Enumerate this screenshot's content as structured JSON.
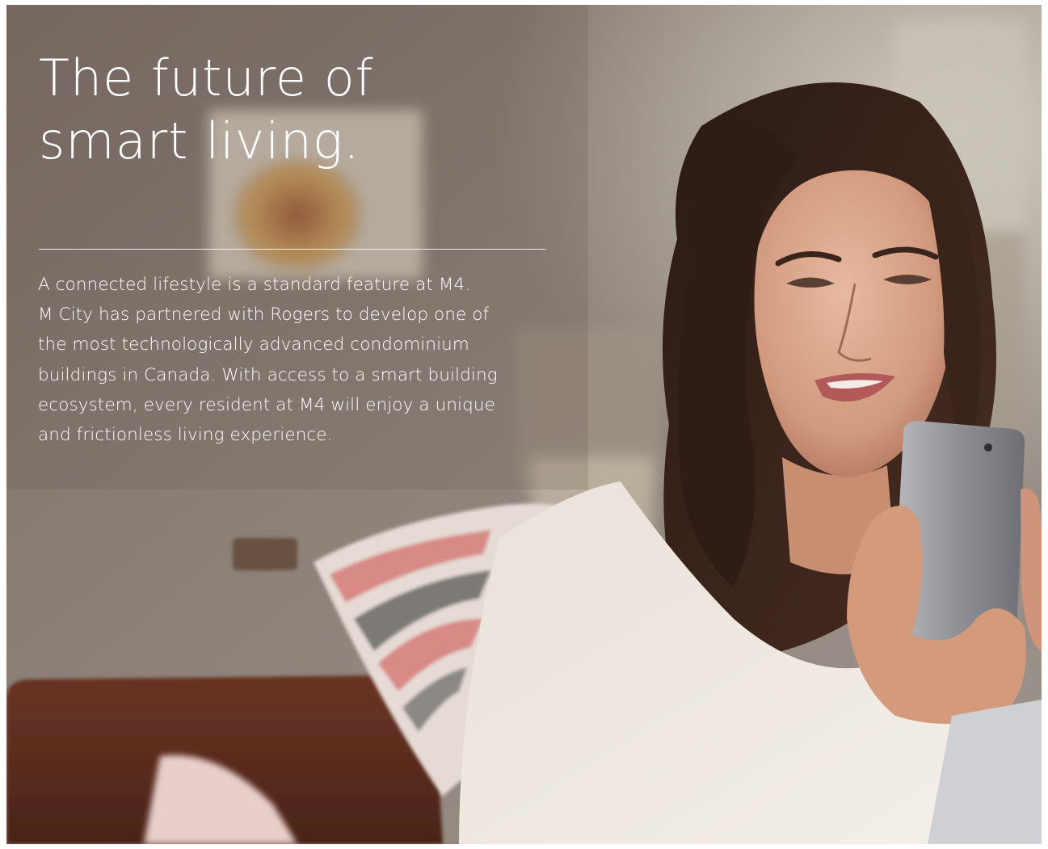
{
  "headline": {
    "line1": "The future of",
    "line2": "smart living."
  },
  "body": {
    "lines": [
      "A connected lifestyle is a standard feature at M4.",
      "M City has partnered with Rogers to develop one of",
      "the most technologically advanced condominium",
      "buildings in Canada. With access to a smart building",
      "ecosystem, every resident at M4 will enjoy a unique",
      "and frictionless living experience."
    ]
  }
}
